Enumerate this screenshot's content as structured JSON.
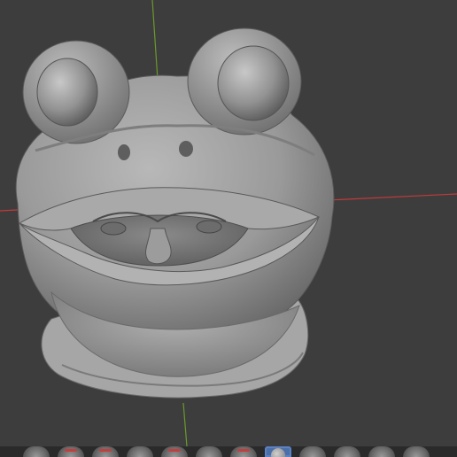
{
  "viewport": {
    "background_color": "#3d3d3d",
    "model_color": "#9b9b9b",
    "x_axis_color": "#c23a3a",
    "y_axis_color": "#6a9a2a",
    "model": "frog-head-sculpt"
  },
  "brush_toolbar": {
    "background_color": "#2a2a2a",
    "active_color": "#4b6fa8",
    "brushes": [
      {
        "icon": "brush-icon"
      },
      {
        "icon": "brush-icon",
        "accent": "red"
      },
      {
        "icon": "brush-icon",
        "accent": "red"
      },
      {
        "icon": "brush-icon"
      },
      {
        "icon": "brush-icon",
        "accent": "red"
      },
      {
        "icon": "brush-icon"
      },
      {
        "icon": "brush-icon",
        "accent": "red"
      },
      {
        "icon": "draw-brush-icon",
        "active": true
      },
      {
        "icon": "brush-icon"
      },
      {
        "icon": "brush-icon"
      },
      {
        "icon": "brush-icon"
      },
      {
        "icon": "brush-icon"
      }
    ]
  }
}
